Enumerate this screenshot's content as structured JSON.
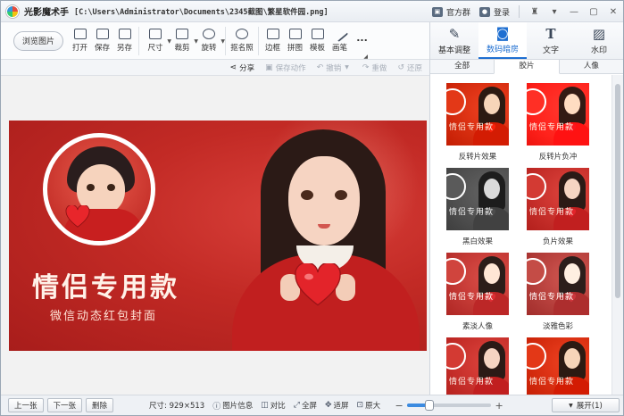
{
  "app": {
    "name": "光影魔术手",
    "file_path": "[C:\\Users\\Administrator\\Documents\\2345截图\\繁星软件园.png]",
    "official_group": "官方群",
    "login": "登录"
  },
  "toolbar": {
    "browse_label": "浏览图片",
    "tools": [
      {
        "label": "打开"
      },
      {
        "label": "保存"
      },
      {
        "label": "另存"
      },
      {
        "label": "尺寸"
      },
      {
        "label": "裁剪"
      },
      {
        "label": "旋转"
      },
      {
        "label": "抠名照"
      },
      {
        "label": "边框"
      },
      {
        "label": "拼图"
      },
      {
        "label": "模板"
      },
      {
        "label": "画笔"
      },
      {
        "label": "..."
      }
    ]
  },
  "actionbar": {
    "share": "分享",
    "save_action": "保存动作",
    "undo": "撤销",
    "redo": "重做",
    "restore": "还原"
  },
  "photo": {
    "title": "情侣专用款",
    "subtitle": "微信动态红包封面"
  },
  "statusbar": {
    "prev": "上一张",
    "next": "下一张",
    "delete": "删除",
    "size_info": "尺寸: 929×513",
    "image_info": "图片信息",
    "compare": "对比",
    "fullscreen": "全屏",
    "fit": "适屏",
    "original": "原大",
    "zoom_fraction": 0.26,
    "expand": "展开(1)"
  },
  "right_panel": {
    "tabs": [
      {
        "label": "基本调整",
        "icon": "adjust-icon"
      },
      {
        "label": "数码暗房",
        "icon": "camera-icon"
      },
      {
        "label": "文字",
        "icon": "text-icon"
      },
      {
        "label": "水印",
        "icon": "watermark-icon"
      }
    ],
    "subtabs": [
      {
        "label": "全部"
      },
      {
        "label": "胶片"
      },
      {
        "label": "人像"
      }
    ],
    "effects": [
      {
        "label": "反转片效果",
        "thumb_text": "情侣专用款"
      },
      {
        "label": "反转片负冲",
        "thumb_text": "情侣专用款"
      },
      {
        "label": "黑白效果",
        "thumb_text": "情侣专用款"
      },
      {
        "label": "负片效果",
        "thumb_text": "情侣专用款"
      },
      {
        "label": "素淡人像",
        "thumb_text": "情侣专用款"
      },
      {
        "label": "淡雅色彩",
        "thumb_text": "情侣专用款"
      },
      {
        "label": "",
        "thumb_text": "情侣专用款"
      },
      {
        "label": "",
        "thumb_text": "情侣专用款"
      }
    ]
  },
  "colors": {
    "accent": "#1f6fd1",
    "photo_red": "#c22a25"
  }
}
